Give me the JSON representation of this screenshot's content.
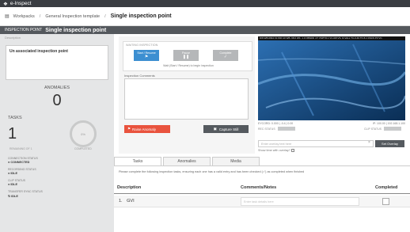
{
  "app": {
    "title": "e-Inspect"
  },
  "breadcrumb": {
    "items": [
      "Workpacks",
      "General Inspection template"
    ],
    "current": "Single inspection point"
  },
  "inspection_point": {
    "label": "INSPECTION POINT",
    "name": "Single inspection point"
  },
  "left": {
    "description_label": "Description",
    "description_text": "Un associated inspection point",
    "anomalies_title": "ANOMALIES",
    "anomalies_count": "0",
    "tasks_title": "TASKS",
    "tasks_count": "1",
    "ring_text": "0%",
    "remaining_text": "REMAINING OF 1",
    "completed_text": "COMPLETED",
    "statuses": [
      {
        "label": "CONNECTION STATUS",
        "value": "CONNECTED"
      },
      {
        "label": "RECORDING STATUS",
        "value": "IDLE"
      },
      {
        "label": "CLIP STATUS",
        "value": "IDLE"
      },
      {
        "label": "TRANSFER SYNC STATUS",
        "value": "IDLE"
      }
    ]
  },
  "middle": {
    "waiting_label": "WAITING INSPECTION",
    "start_resume": "Start / Resume",
    "pause": "Pause",
    "complete": "Complete",
    "wait_hint": "Wait (Start / Resume) to begin inspection",
    "comments_label": "Inspection Comments",
    "raise_anomaly": "Raise Anomaly",
    "capture_still": "Capture Still"
  },
  "video": {
    "header": "DW.WB.0994  F1:WR 1D  WB. 98.0  WK. 1.0  OBSRD .07  VSPTR.1  VC-0W.VS.  R-VALL  TC-0.40.TK  8-1  DSCS  P3  VC.",
    "eycord": "EYCORD: 0.000 | -0.4 | 0.00",
    "ip": "IP: 100.00 | 192.168.1.100",
    "rec_status_label": "REC STATUS",
    "clip_status_label": "CLIP STATUS",
    "overlay_placeholder": "Enter overlay text here",
    "set_overlay": "Set Overlay",
    "show_time": "Show time with overlay?"
  },
  "tabs": [
    {
      "label": "Tasks"
    },
    {
      "label": "Anomalies"
    },
    {
      "label": "Media"
    }
  ],
  "instructions": "Please complete the following inspection tasks, ensuring each one has a valid entry and has been checked (✓) as completed when finished",
  "table": {
    "headers": [
      "Description",
      "Comments/Notes",
      "Completed"
    ],
    "rows": [
      {
        "index": "1.",
        "description": "GVI",
        "notes_placeholder": "Enter task details here"
      }
    ]
  },
  "colors": {
    "topbar": "#3a3d42",
    "ip_bar": "#54585d",
    "accent": "#3c8fd1",
    "danger": "#e9533e"
  }
}
